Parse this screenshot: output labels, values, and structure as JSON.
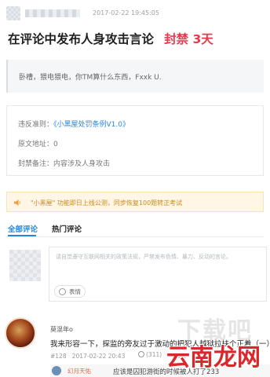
{
  "header": {
    "timestamp": "2017-02-22 19:45:05"
  },
  "post": {
    "title": "在评论中发布人身攻击言论",
    "ban_label": "封禁 3天",
    "quote": "卧槽，猥电猥电，你TM算什么东西，Fxxk U."
  },
  "info": {
    "rule_label": "违反准则：",
    "rule_link": "《小黑屋处罚条例V1.0》",
    "origin": "原文地址：0",
    "note": "封禁备注：内容涉及人身攻击"
  },
  "notice": {
    "text": "\"小黑屋\" 功能即日上线公测，同步恢复100题转正考试"
  },
  "tabs": [
    {
      "label": "全部评论"
    },
    {
      "label": "热门评论"
    }
  ],
  "comment_box": {
    "placeholder": "请自觉遵守互联网相关的政策法规，严禁发布色情、暴力、反动的言论。",
    "emoji_label": "表情"
  },
  "reply": {
    "name": "莫混年o",
    "text": "我来形容一下，探监的旁友过于激动的把犯人越狱拉扶个正着（一）",
    "floor": "#128",
    "time": "2017-02-22 20:43",
    "likes": "(311)",
    "reply_label": "回复",
    "sub": {
      "name": "幻月天佑",
      "text": "应该是囚犯游街的时候被人打了233"
    }
  },
  "watermark": {
    "dim_text": "下载吧",
    "text": "云南龙网"
  }
}
